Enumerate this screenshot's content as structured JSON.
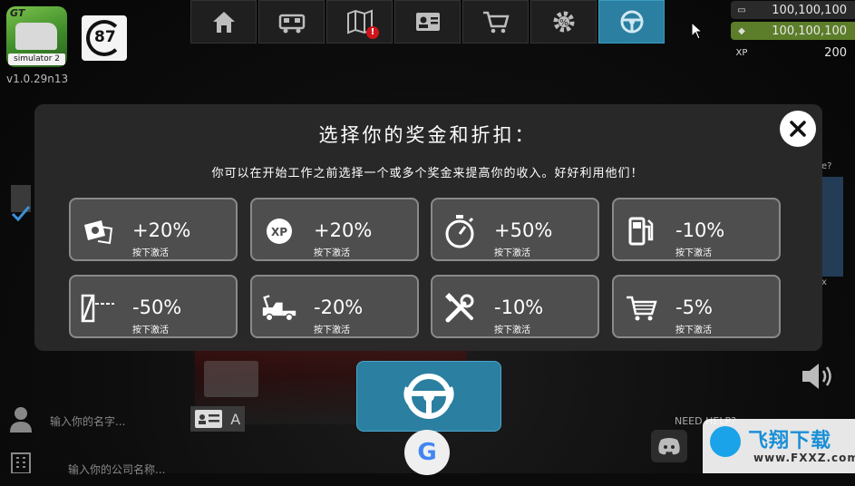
{
  "game": {
    "logo_top": "GT",
    "logo_bottom": "simulator 2",
    "version": "v1.0.29n13",
    "badge_number": "87"
  },
  "nav": {
    "items": [
      {
        "name": "home-icon",
        "active": false,
        "badge": ""
      },
      {
        "name": "garage-icon",
        "active": false,
        "badge": ""
      },
      {
        "name": "map-icon",
        "active": false,
        "badge": "!"
      },
      {
        "name": "profile-card-icon",
        "active": false,
        "badge": ""
      },
      {
        "name": "shop-cart-icon",
        "active": false,
        "badge": ""
      },
      {
        "name": "settings-gear-icon",
        "active": false,
        "badge": ""
      },
      {
        "name": "steering-wheel-icon",
        "active": true,
        "badge": ""
      }
    ]
  },
  "currency": {
    "money": "100,100,100",
    "gems": "100,100,100",
    "xp_label": "XP",
    "xp": "200"
  },
  "modal": {
    "title": "选择你的奖金和折扣：",
    "subtitle": "你可以在开始工作之前选择一个或多个奖金来提高你的收入。好好利用他们！",
    "bonuses": [
      {
        "icon": "money-bonus-icon",
        "value": "+20%",
        "action": "按下激活"
      },
      {
        "icon": "xp-bonus-icon",
        "value": "+20%",
        "action": "按下激活"
      },
      {
        "icon": "stopwatch-icon",
        "value": "+50%",
        "action": "按下激活"
      },
      {
        "icon": "fuel-pump-icon",
        "value": "-10%",
        "action": "按下激活"
      },
      {
        "icon": "toll-gate-icon",
        "value": "-50%",
        "action": "按下激活"
      },
      {
        "icon": "tow-truck-icon",
        "value": "-20%",
        "action": "按下激活"
      },
      {
        "icon": "repair-tools-icon",
        "value": "-10%",
        "action": "按下激活"
      },
      {
        "icon": "shop-cart-icon",
        "value": "-5%",
        "action": "按下激活"
      }
    ]
  },
  "bottom": {
    "name_placeholder": "输入你的名字...",
    "company_placeholder": "输入你的公司名称...",
    "idcard_letter": "A",
    "google_letter": "G",
    "need_help": "NEED HELP?"
  },
  "watermark": {
    "text": "飞翔下载",
    "url": "www.FXXZ.com"
  },
  "colors": {
    "accent": "#2b7fa0",
    "gem_bg": "#5c7d29",
    "modal_bg": "#2a2a2a",
    "tile_bg": "#4e4e4e"
  }
}
